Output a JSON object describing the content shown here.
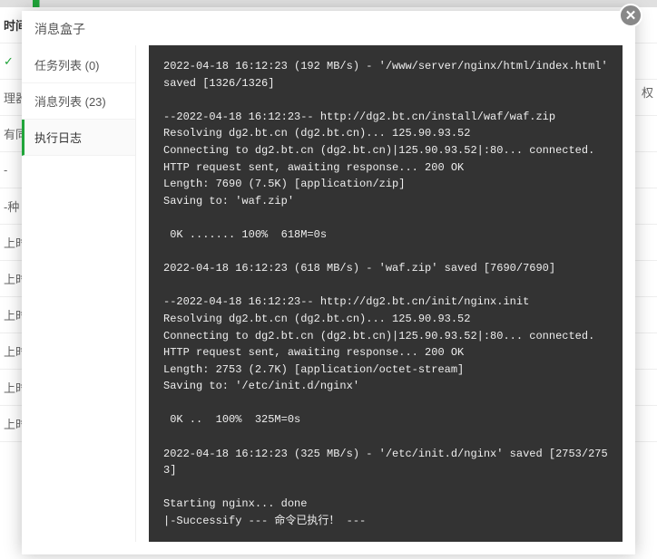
{
  "background": {
    "header_col": "时间",
    "check": "✓",
    "auth_label": "权",
    "rows": [
      "理器",
      "有同",
      "-",
      "-种",
      "上时",
      "上时",
      "上时",
      "上时",
      "上时",
      "上时"
    ]
  },
  "modal": {
    "title": "消息盒子",
    "close_glyph": "✕",
    "tabs": [
      {
        "label": "任务列表 (0)",
        "key": "tasks"
      },
      {
        "label": "消息列表 (23)",
        "key": "messages"
      },
      {
        "label": "执行日志",
        "key": "log",
        "active": true
      }
    ],
    "log_lines": [
      "2022-04-18 16:12:23 (192 MB/s) - '/www/server/nginx/html/index.html' saved [1326/1326]",
      "",
      "--2022-04-18 16:12:23-- http://dg2.bt.cn/install/waf/waf.zip",
      "Resolving dg2.bt.cn (dg2.bt.cn)... 125.90.93.52",
      "Connecting to dg2.bt.cn (dg2.bt.cn)|125.90.93.52|:80... connected.",
      "HTTP request sent, awaiting response... 200 OK",
      "Length: 7690 (7.5K) [application/zip]",
      "Saving to: 'waf.zip'",
      "",
      " 0K ....... 100%  618M=0s",
      "",
      "2022-04-18 16:12:23 (618 MB/s) - 'waf.zip' saved [7690/7690]",
      "",
      "--2022-04-18 16:12:23-- http://dg2.bt.cn/init/nginx.init",
      "Resolving dg2.bt.cn (dg2.bt.cn)... 125.90.93.52",
      "Connecting to dg2.bt.cn (dg2.bt.cn)|125.90.93.52|:80... connected.",
      "HTTP request sent, awaiting response... 200 OK",
      "Length: 2753 (2.7K) [application/octet-stream]",
      "Saving to: '/etc/init.d/nginx'",
      "",
      " 0K ..  100%  325M=0s",
      "",
      "2022-04-18 16:12:23 (325 MB/s) - '/etc/init.d/nginx' saved [2753/2753]",
      "",
      "Starting nginx... done",
      "|-Successify --- 命令已执行！ ---"
    ]
  }
}
